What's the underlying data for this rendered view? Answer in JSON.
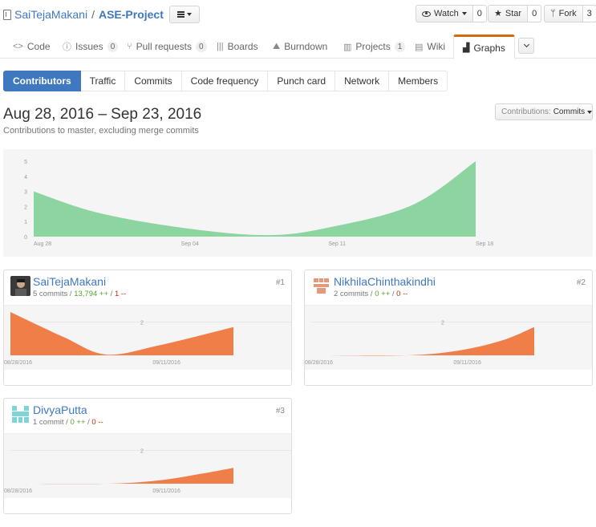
{
  "repo": {
    "owner": "SaiTejaMakani",
    "separator": "/",
    "name": "ASE-Project"
  },
  "social": {
    "watch_label": "Watch",
    "watch_count": "0",
    "star_label": "Star",
    "star_count": "0",
    "fork_label": "Fork",
    "fork_count": "3"
  },
  "nav": {
    "code": "Code",
    "issues": "Issues",
    "issues_count": "0",
    "pulls": "Pull requests",
    "pulls_count": "0",
    "boards": "Boards",
    "burndown": "Burndown",
    "projects": "Projects",
    "projects_count": "1",
    "wiki": "Wiki",
    "graphs": "Graphs"
  },
  "subnav": [
    "Contributors",
    "Traffic",
    "Commits",
    "Code frequency",
    "Punch card",
    "Network",
    "Members"
  ],
  "range": {
    "title": "Aug 28, 2016 – Sep 23, 2016",
    "subtitle": "Contributions to master, excluding merge commits"
  },
  "contrib_select": {
    "prefix": "Contributions:",
    "value": "Commits"
  },
  "colors": {
    "accent": "#4078c0",
    "main_area": "#8cd4a0",
    "contrib_area": "#f07e48",
    "tab_highlight": "#d26911"
  },
  "chart_data": [
    {
      "type": "area",
      "x": [
        "Aug 28",
        "Aug 31",
        "Sep 04",
        "Sep 08",
        "Sep 11",
        "Sep 15",
        "Sep 18"
      ],
      "y": [
        3,
        1.6,
        0.6,
        0.1,
        0.6,
        2.1,
        5
      ],
      "x_tick_labels": [
        "Aug 28",
        "Sep 04",
        "Sep 11",
        "Sep 18"
      ],
      "y_tick_labels": [
        "0",
        "1",
        "2",
        "3",
        "4",
        "5"
      ],
      "ylim": [
        0,
        5
      ]
    },
    {
      "type": "area",
      "x": [
        "08/28/2016",
        "09/02/2016",
        "09/06/2016",
        "09/11/2016",
        "09/18/2016"
      ],
      "y": [
        2.6,
        1.1,
        0.05,
        0.6,
        1.7
      ],
      "x_tick_labels": [
        "08/28/2016",
        "09/11/2016"
      ],
      "y_tick_labels": [
        "2"
      ],
      "ylim": [
        0,
        2.6
      ]
    },
    {
      "type": "area",
      "x": [
        "08/28/2016",
        "09/06/2016",
        "09/11/2016",
        "09/15/2016",
        "09/18/2016"
      ],
      "y": [
        0,
        0,
        0.3,
        0.9,
        1.7
      ],
      "x_tick_labels": [
        "08/28/2016",
        "09/11/2016"
      ],
      "y_tick_labels": [
        "2"
      ],
      "ylim": [
        0,
        2.6
      ]
    },
    {
      "type": "area",
      "x": [
        "08/28/2016",
        "09/06/2016",
        "09/11/2016",
        "09/15/2016",
        "09/18/2016"
      ],
      "y": [
        0,
        0,
        0.2,
        0.6,
        0.95
      ],
      "x_tick_labels": [
        "08/28/2016",
        "09/11/2016"
      ],
      "y_tick_labels": [
        "2"
      ],
      "ylim": [
        0,
        2.6
      ]
    }
  ],
  "contributors": [
    {
      "name": "SaiTejaMakani",
      "commits": "5 commits",
      "adds": "13,794 ++",
      "dels": "1 --",
      "rank": "#1"
    },
    {
      "name": "NikhilaChinthakindhi",
      "commits": "2 commits",
      "adds": "0 ++",
      "dels": "0 --",
      "rank": "#2"
    },
    {
      "name": "DivyaPutta",
      "commits": "1 commit",
      "adds": "0 ++",
      "dels": "0 --",
      "rank": "#3"
    }
  ]
}
